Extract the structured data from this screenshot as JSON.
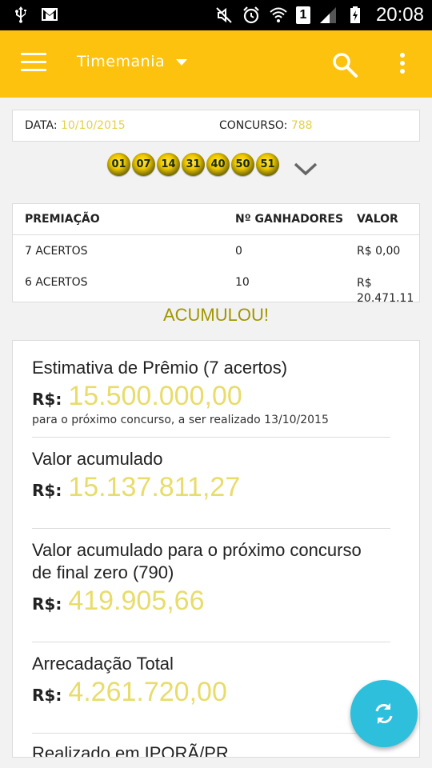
{
  "statusbar": {
    "time": "20:08",
    "sim_slot": "1"
  },
  "appbar": {
    "title": "Timemania"
  },
  "draw": {
    "date_label": "DATA:",
    "date_value": "10/10/2015",
    "contest_label": "CONCURSO:",
    "contest_value": "788",
    "numbers": [
      "01",
      "07",
      "14",
      "31",
      "40",
      "50",
      "51"
    ]
  },
  "results": {
    "headers": [
      "PREMIAÇÃO",
      "Nº GANHADORES",
      "VALOR"
    ],
    "rows": [
      {
        "prize": "7 ACERTOS",
        "winners": "0",
        "value": "R$ 0,00"
      },
      {
        "prize": "6 ACERTOS",
        "winners": "10",
        "value": "R$ 20.471,11"
      }
    ]
  },
  "status": {
    "accumulated": "ACUMULOU!"
  },
  "prize": {
    "currency": "R$:",
    "estimate_title": "Estimativa de Prêmio (7 acertos)",
    "estimate_value": "15.500.000,00",
    "estimate_note": "para o próximo concurso, a ser realizado 13/10/2015",
    "accum_title": "Valor acumulado",
    "accum_value": "15.137.811,27",
    "zero_title_line1": "Valor acumulado para o próximo concurso",
    "zero_title_line2": "de final zero (790)",
    "zero_value": "419.905,66",
    "collection_title": "Arrecadação Total",
    "collection_value": "4.261.720,00",
    "location_partial": "Realizado em IPORÃ/PR"
  },
  "colors": {
    "accent": "#fdc20e",
    "value": "#e8dc6a",
    "fab": "#2ebfdc"
  },
  "icons": [
    "usb-icon",
    "gmail-icon",
    "mute-icon",
    "alarm-icon",
    "wifi-icon",
    "signal-icon",
    "battery-icon",
    "menu-icon",
    "dropdown-caret-icon",
    "search-icon",
    "more-vert-icon",
    "chevron-down-icon",
    "refresh-icon"
  ]
}
